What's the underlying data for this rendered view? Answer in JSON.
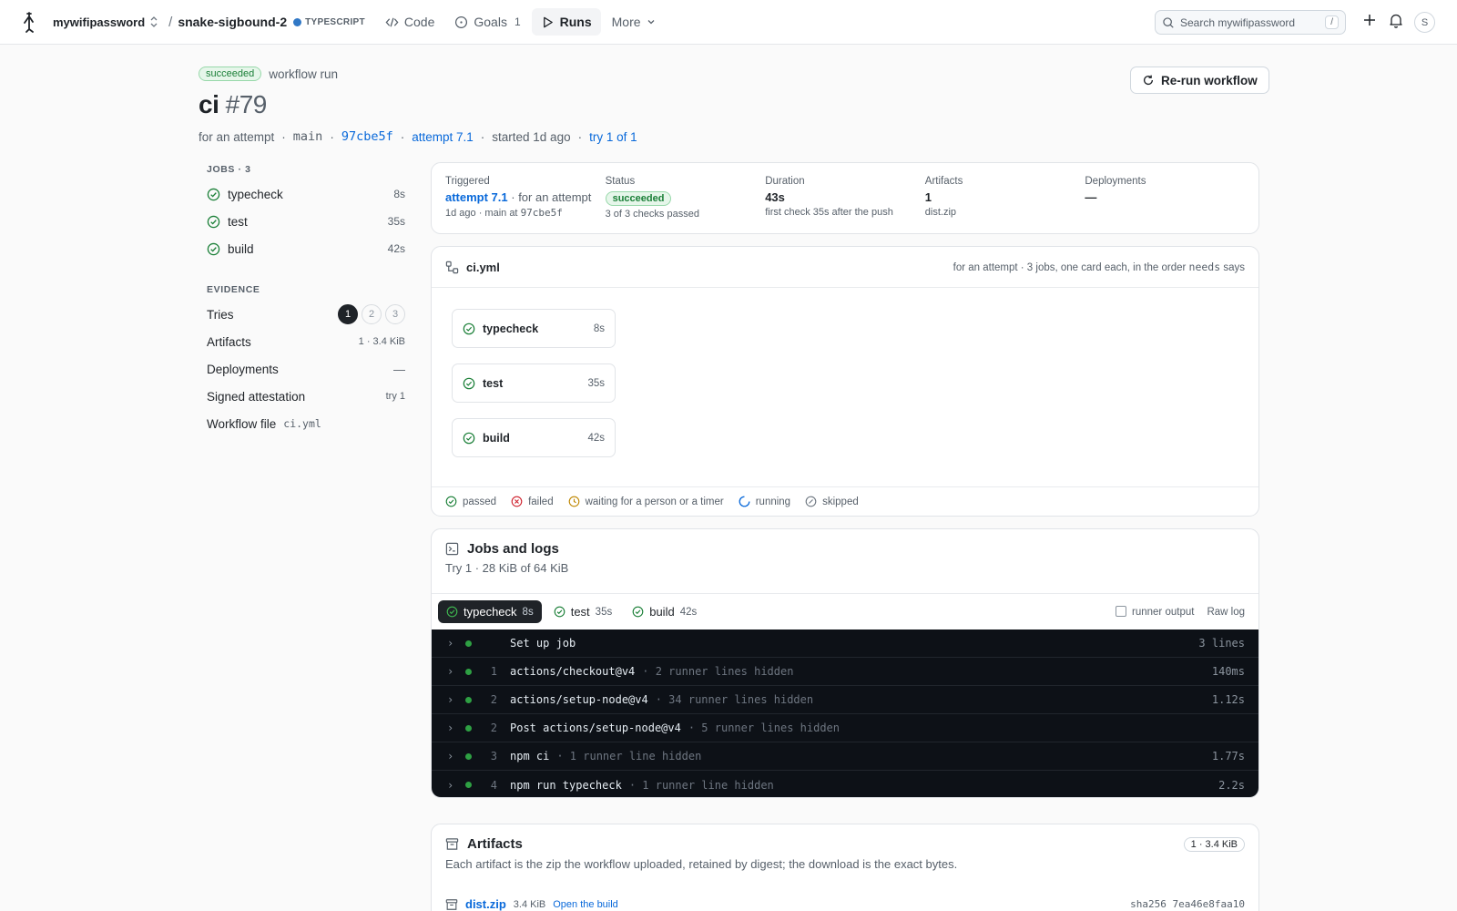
{
  "topbar": {
    "owner": "mywifipassword",
    "slash": "/",
    "repo": "snake-sigbound-2",
    "language": "TYPESCRIPT",
    "nav": [
      {
        "label": "Code",
        "count": ""
      },
      {
        "label": "Goals",
        "count": "1"
      },
      {
        "label": "Runs",
        "count": ""
      },
      {
        "label": "More",
        "count": ""
      }
    ],
    "search_placeholder": "Search mywifipassword",
    "search_kbd": "/",
    "avatar": "S"
  },
  "run": {
    "status": "succeeded",
    "kind": "workflow run",
    "name": "ci",
    "number": "#79",
    "meta": {
      "event": "for an attempt",
      "branch": "main",
      "commit": "97cbe5f",
      "attempt": "attempt 7.1",
      "started": "started 1d ago",
      "try": "try 1 of 1",
      "sep": "·"
    },
    "rerun_label": "Re-run workflow"
  },
  "sidebar": {
    "jobs_heading": "JOBS · 3",
    "jobs": [
      {
        "name": "typecheck",
        "duration": "8s"
      },
      {
        "name": "test",
        "duration": "35s"
      },
      {
        "name": "build",
        "duration": "42s"
      }
    ],
    "evidence_heading": "EVIDENCE",
    "tries_label": "Tries",
    "tries": [
      "1",
      "2",
      "3"
    ],
    "artifacts_label": "Artifacts",
    "artifacts_value": "1 · 3.4 KiB",
    "deployments_label": "Deployments",
    "deployments_value": "—",
    "attestation_label": "Signed attestation",
    "attestation_value": "try 1",
    "workflow_label": "Workflow file",
    "workflow_value": "ci.yml"
  },
  "summary": {
    "triggered": {
      "label": "Triggered",
      "link": "attempt 7.1",
      "rest": " · for an attempt",
      "sub_prefix": "1d ago · main at ",
      "sub_commit": "97cbe5f"
    },
    "status": {
      "label": "Status",
      "value": "succeeded",
      "sub": "3 of 3 checks passed"
    },
    "duration": {
      "label": "Duration",
      "value": "43s",
      "sub": "first check 35s after the push"
    },
    "artifacts": {
      "label": "Artifacts",
      "value": "1",
      "sub": "dist.zip"
    },
    "deployments": {
      "label": "Deployments",
      "value": "—",
      "sub": ""
    }
  },
  "graph": {
    "file": "ci.yml",
    "note_prefix": "for an attempt · 3 jobs, one card each, in the order ",
    "note_code": "needs",
    "note_suffix": " says",
    "nodes": [
      {
        "name": "typecheck",
        "duration": "8s"
      },
      {
        "name": "test",
        "duration": "35s"
      },
      {
        "name": "build",
        "duration": "42s"
      }
    ],
    "legend": {
      "passed": "passed",
      "failed": "failed",
      "waiting": "waiting for a person or a timer",
      "running": "running",
      "skipped": "skipped"
    }
  },
  "jobs_logs": {
    "title": "Jobs and logs",
    "subtitle": "Try 1 · 28 KiB of 64 KiB",
    "tabs": [
      {
        "name": "typecheck",
        "duration": "8s"
      },
      {
        "name": "test",
        "duration": "35s"
      },
      {
        "name": "build",
        "duration": "42s"
      }
    ],
    "runner_output": "runner output",
    "raw_log": "Raw log",
    "steps": [
      {
        "no": "",
        "name": "Set up job",
        "sub": "",
        "right": "3 lines"
      },
      {
        "no": "1",
        "name": "actions/checkout@v4",
        "sub": "· 2 runner lines hidden",
        "right": "140ms"
      },
      {
        "no": "2",
        "name": "actions/setup-node@v4",
        "sub": "· 34 runner lines hidden",
        "right": "1.12s"
      },
      {
        "no": "2",
        "name": "Post actions/setup-node@v4",
        "sub": "· 5 runner lines hidden",
        "right": ""
      },
      {
        "no": "3",
        "name": "npm ci",
        "sub": "· 1 runner line hidden",
        "right": "1.77s"
      },
      {
        "no": "4",
        "name": "npm run typecheck",
        "sub": "· 1 runner line hidden",
        "right": "2.2s"
      }
    ]
  },
  "artifacts_card": {
    "title": "Artifacts",
    "pill": "1 · 3.4 KiB",
    "desc": "Each artifact is the zip the workflow uploaded, retained by digest; the download is the exact bytes.",
    "item": {
      "name": "dist.zip",
      "size": "3.4 KiB",
      "link": "Open the build",
      "digest": "sha256 7ea46e8faa10"
    }
  },
  "colors": {
    "success": "#1a7f37",
    "accent": "#0969da",
    "failed": "#cf222e",
    "waiting": "#bf8700",
    "running": "#0969da",
    "dark": "#0d1117"
  }
}
